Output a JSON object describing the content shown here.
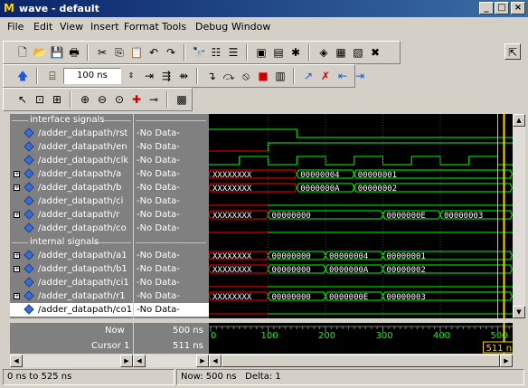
{
  "window": {
    "title": "wave - default",
    "min": "_",
    "max": "□",
    "close": "×"
  },
  "menu": [
    "File",
    "Edit",
    "View",
    "Insert",
    "Format",
    "Tools",
    "Debug",
    "Window"
  ],
  "toolbar2": {
    "time_value": "100",
    "time_unit": "ns"
  },
  "groups": {
    "interface": "interface signals",
    "internal": "internal signals"
  },
  "signals": [
    {
      "name": "/adder_datapath/rst",
      "value": "-No Data-",
      "expandable": false
    },
    {
      "name": "/adder_datapath/en",
      "value": "-No Data-",
      "expandable": false
    },
    {
      "name": "/adder_datapath/clk",
      "value": "-No Data-",
      "expandable": false
    },
    {
      "name": "/adder_datapath/a",
      "value": "-No Data-",
      "expandable": true
    },
    {
      "name": "/adder_datapath/b",
      "value": "-No Data-",
      "expandable": true
    },
    {
      "name": "/adder_datapath/ci",
      "value": "-No Data-",
      "expandable": false
    },
    {
      "name": "/adder_datapath/r",
      "value": "-No Data-",
      "expandable": true
    },
    {
      "name": "/adder_datapath/co",
      "value": "-No Data-",
      "expandable": false
    },
    {
      "name": "/adder_datapath/a1",
      "value": "-No Data-",
      "expandable": true
    },
    {
      "name": "/adder_datapath/b1",
      "value": "-No Data-",
      "expandable": true
    },
    {
      "name": "/adder_datapath/ci1",
      "value": "-No Data-",
      "expandable": false
    },
    {
      "name": "/adder_datapath/r1",
      "value": "-No Data-",
      "expandable": true
    },
    {
      "name": "/adder_datapath/co1",
      "value": "-No Data-",
      "expandable": false
    }
  ],
  "bus_values": {
    "a": [
      "XXXXXXXX",
      "00000004",
      "00000001"
    ],
    "b": [
      "XXXXXXXX",
      "0000000A",
      "00000002"
    ],
    "r": [
      "XXXXXXXX",
      "00000000",
      "0000000E",
      "00000003"
    ],
    "a1": [
      "XXXXXXXX",
      "00000000",
      "00000004",
      "00000001"
    ],
    "b1": [
      "XXXXXXXX",
      "00000000",
      "0000000A",
      "00000002"
    ],
    "r1": [
      "XXXXXXXX",
      "00000000",
      "0000000E",
      "00000003"
    ]
  },
  "cursor_panel": {
    "now_label": "Now",
    "now_value": "500 ns",
    "cursor_label": "Cursor 1",
    "cursor_value": "511 ns",
    "cursor_tag": "511 ns",
    "ticks": [
      "0",
      "100",
      "200",
      "300",
      "400",
      "500"
    ]
  },
  "status": {
    "range": "0 ns to 525 ns",
    "now": "Now: 500 ns",
    "delta": "Delta: 1"
  },
  "colors": {
    "wave": "#00ff00",
    "undefined": "#ff0000",
    "cursor": "#ffd200",
    "background": "#000000"
  }
}
